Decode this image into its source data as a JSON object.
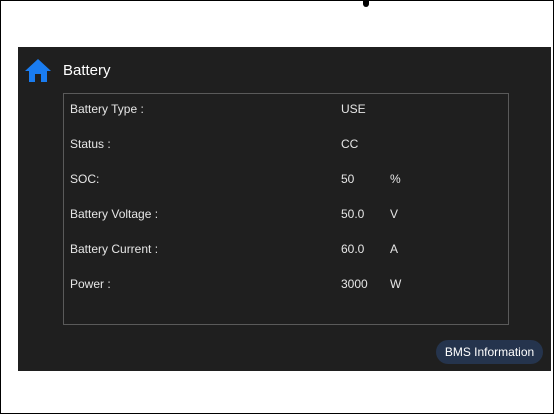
{
  "header": {
    "title": "Battery",
    "home_icon": "home-icon",
    "accent_color": "#1a7cf0"
  },
  "panel": {
    "rows": [
      {
        "label": "Battery Type :",
        "value": "USE",
        "unit": ""
      },
      {
        "label": "Status :",
        "value": "CC",
        "unit": ""
      },
      {
        "label": "SOC:",
        "value": "50",
        "unit": "%"
      },
      {
        "label": "Battery Voltage :",
        "value": "50.0",
        "unit": "V"
      },
      {
        "label": "Battery Current :",
        "value": "60.0",
        "unit": "A"
      },
      {
        "label": "Power :",
        "value": "3000",
        "unit": "W"
      }
    ]
  },
  "footer": {
    "bms_button_label": "BMS Information",
    "bms_button_color": "#25344d"
  },
  "colors": {
    "screen_background": "#1f1f1f",
    "text": "#e6e6e6",
    "panel_border": "#5a5a5a"
  }
}
